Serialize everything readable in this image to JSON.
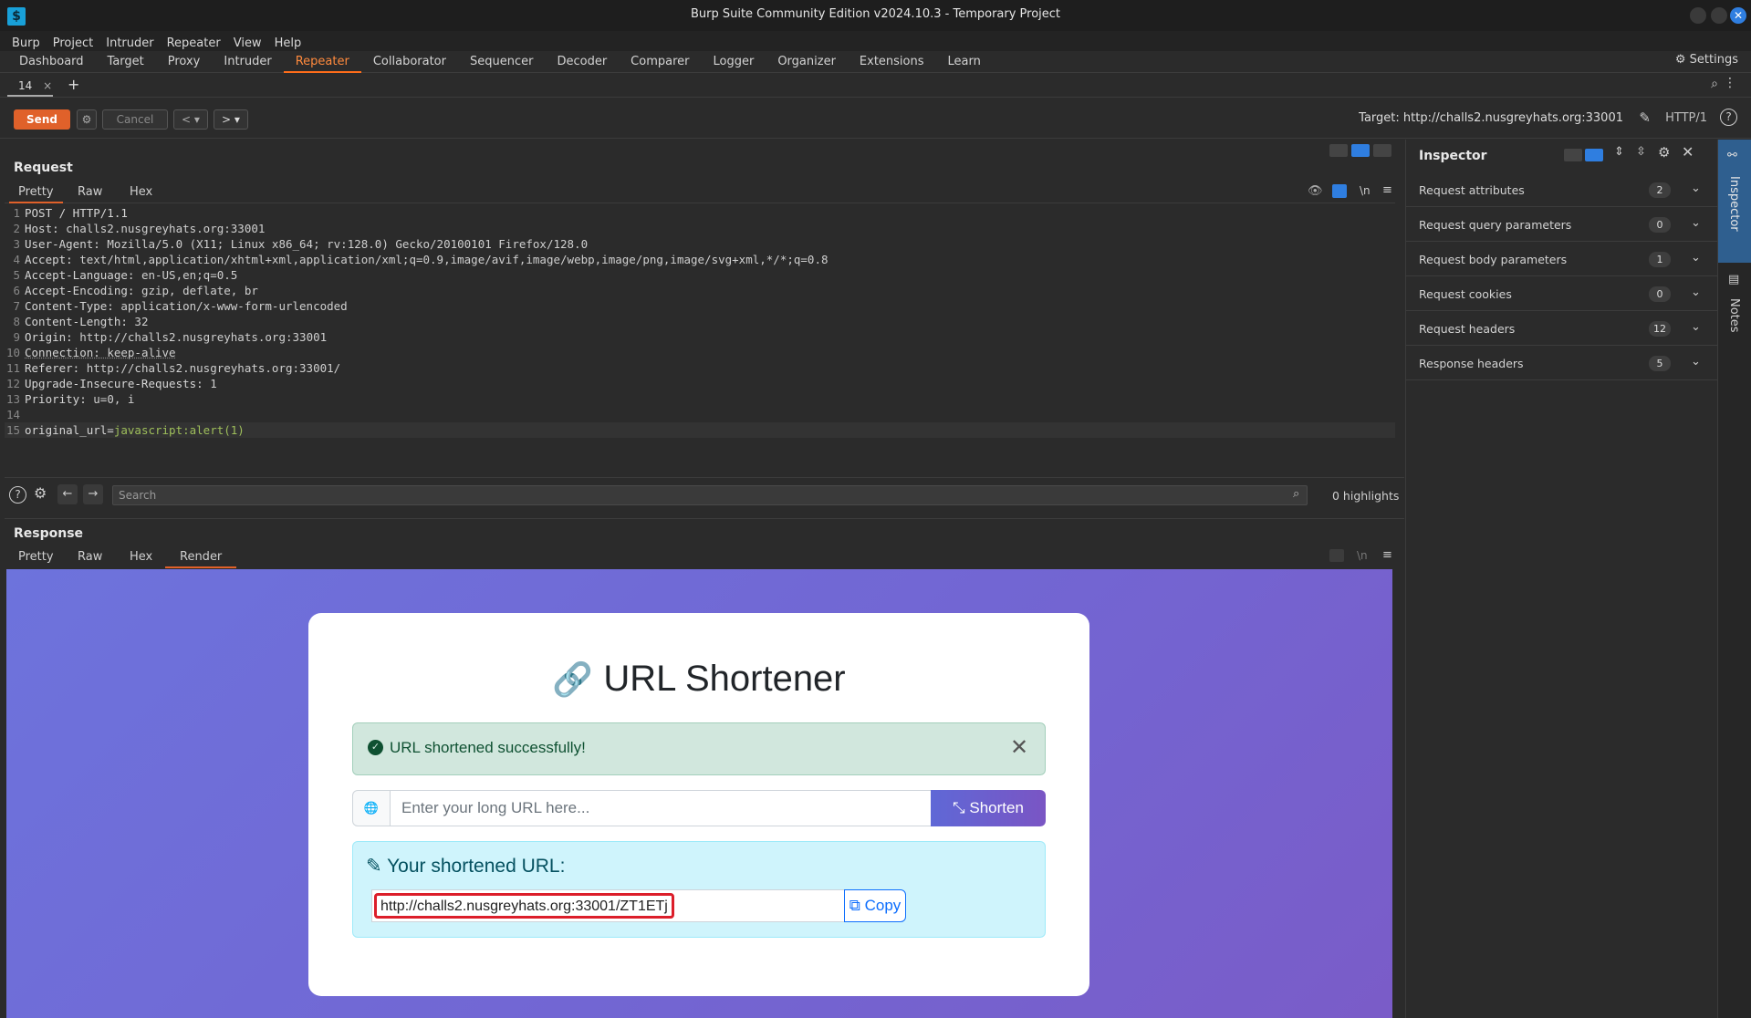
{
  "window": {
    "title": "Burp Suite Community Edition v2024.10.3 - Temporary Project",
    "logo_glyph": "$"
  },
  "menu": [
    "Burp",
    "Project",
    "Intruder",
    "Repeater",
    "View",
    "Help"
  ],
  "main_tabs": [
    "Dashboard",
    "Target",
    "Proxy",
    "Intruder",
    "Repeater",
    "Collaborator",
    "Sequencer",
    "Decoder",
    "Comparer",
    "Logger",
    "Organizer",
    "Extensions",
    "Learn"
  ],
  "active_main_tab": "Repeater",
  "settings_label": "Settings",
  "repeater_tab": {
    "label": "14",
    "close": "×"
  },
  "toolbar": {
    "send": "Send",
    "cancel": "Cancel",
    "target": "Target: http://challs2.nusgreyhats.org:33001",
    "http_version": "HTTP/1"
  },
  "request": {
    "title": "Request",
    "tabs": [
      "Pretty",
      "Raw",
      "Hex"
    ],
    "wrap_label": "\\n",
    "lines": [
      {
        "n": "1",
        "k": "POST / HTTP/1.1",
        "v": ""
      },
      {
        "n": "2",
        "k": "Host: ",
        "v": "challs2.nusgreyhats.org:33001"
      },
      {
        "n": "3",
        "k": "User-Agent: ",
        "v": "Mozilla/5.0 (X11; Linux x86_64; rv:128.0) Gecko/20100101 Firefox/128.0"
      },
      {
        "n": "4",
        "k": "Accept: ",
        "v": "text/html,application/xhtml+xml,application/xml;q=0.9,image/avif,image/webp,image/png,image/svg+xml,*/*;q=0.8"
      },
      {
        "n": "5",
        "k": "Accept-Language: ",
        "v": "en-US,en;q=0.5"
      },
      {
        "n": "6",
        "k": "Accept-Encoding: ",
        "v": "gzip, deflate, br"
      },
      {
        "n": "7",
        "k": "Content-Type: ",
        "v": "application/x-www-form-urlencoded"
      },
      {
        "n": "8",
        "k": "Content-Length: ",
        "v": "32"
      },
      {
        "n": "9",
        "k": "Origin: ",
        "v": "http://challs2.nusgreyhats.org:33001"
      },
      {
        "n": "10",
        "k": "Connection: ",
        "v": "keep-alive"
      },
      {
        "n": "11",
        "k": "Referer: ",
        "v": "http://challs2.nusgreyhats.org:33001/"
      },
      {
        "n": "12",
        "k": "Upgrade-Insecure-Requests: ",
        "v": "1"
      },
      {
        "n": "13",
        "k": "Priority: ",
        "v": "u=0, i"
      },
      {
        "n": "14",
        "k": "",
        "v": ""
      },
      {
        "n": "15",
        "k": "original_url=",
        "v": "javascript:alert(1)"
      }
    ],
    "search_placeholder": "Search",
    "highlights": "0 highlights"
  },
  "response": {
    "title": "Response",
    "tabs": [
      "Pretty",
      "Raw",
      "Hex",
      "Render"
    ],
    "active_tab": "Render",
    "wrap_label": "\\n",
    "rendered": {
      "heading": "URL Shortener",
      "alert": "URL shortened successfully!",
      "input_placeholder": "Enter your long URL here...",
      "shorten_button": "Shorten",
      "shortened_label": "Your shortened URL:",
      "shortened_url": "http://challs2.nusgreyhats.org:33001/ZT1ETj",
      "copy_button": "Copy"
    }
  },
  "inspector": {
    "title": "Inspector",
    "rows": [
      {
        "label": "Request attributes",
        "count": "2"
      },
      {
        "label": "Request query parameters",
        "count": "0"
      },
      {
        "label": "Request body parameters",
        "count": "1"
      },
      {
        "label": "Request cookies",
        "count": "0"
      },
      {
        "label": "Request headers",
        "count": "12"
      },
      {
        "label": "Response headers",
        "count": "5"
      }
    ]
  },
  "right_sidebar": [
    "Inspector",
    "Notes"
  ],
  "colors": {
    "accent": "#e0612a",
    "active_tab": "#ff8a3d",
    "render_gradient_start": "#6d73dc",
    "render_gradient_end": "#7a5cc8",
    "success_bg": "#d1e7dd",
    "shorten_btn": "#6b64d6",
    "highlight_box": "#dc1e2a"
  }
}
